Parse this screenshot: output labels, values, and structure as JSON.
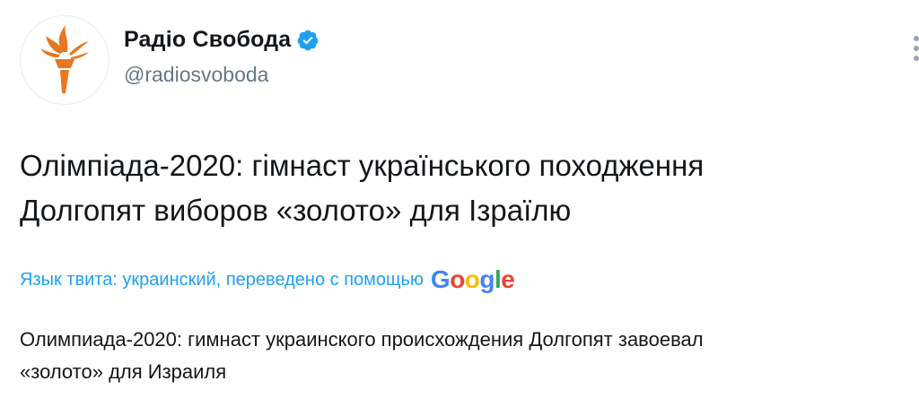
{
  "account": {
    "display_name": "Радіо Свобода",
    "handle": "@radiosvoboda",
    "verified": true,
    "avatar_icon": "rferl-torch-logo",
    "brand_color": "#e87722"
  },
  "tweet": {
    "text_line1": "Олімпіада-2020: гімнаст українського походження",
    "text_line2": "Долгопят виборов «золото» для Ізраїлю"
  },
  "translation": {
    "label": "Язык твита: украинский, переведено с помощью",
    "provider": "Google",
    "text_line1": "Олимпиада-2020: гимнаст украинского происхождения Долгопят завоевал",
    "text_line2": "«золото» для Израиля",
    "accent_color": "#1da1f2"
  }
}
